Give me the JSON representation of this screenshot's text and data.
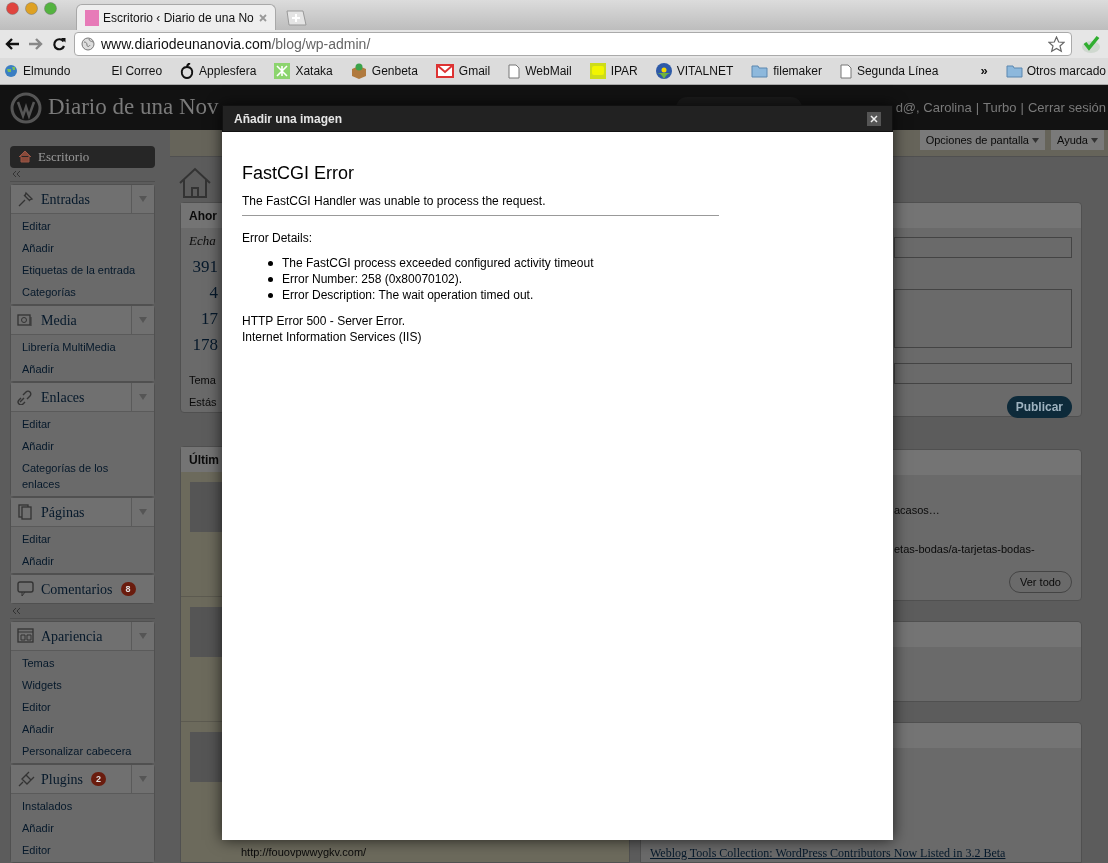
{
  "browser": {
    "tab": {
      "title": "Escritorio ‹ Diario de una No"
    },
    "address": {
      "domain": "www.diariodeunanovia.com",
      "path": "/blog/wp-admin/"
    },
    "bookmarks": [
      {
        "label": "Elmundo",
        "kind": "globe"
      },
      {
        "label": "El Correo",
        "kind": "none"
      },
      {
        "label": "Applesfera",
        "kind": "apple"
      },
      {
        "label": "Xataka",
        "kind": "xataka"
      },
      {
        "label": "Genbeta",
        "kind": "box"
      },
      {
        "label": "Gmail",
        "kind": "mail"
      },
      {
        "label": "WebMail",
        "kind": "page"
      },
      {
        "label": "IPAR",
        "kind": "bubble"
      },
      {
        "label": "VITALNET",
        "kind": "vital"
      },
      {
        "label": "filemaker",
        "kind": "folder"
      },
      {
        "label": "Segunda Línea",
        "kind": "page"
      }
    ],
    "overflow": "»",
    "other_bookmarks": "Otros marcado"
  },
  "admin_bar": {
    "site_title": "Diario de una Nov",
    "greeting": "d@, Carolina",
    "separator": "|",
    "links": [
      "Turbo",
      "Cerrar sesión"
    ]
  },
  "screen_buttons": [
    "Opciones de pantalla",
    "Ayuda"
  ],
  "sidebar": {
    "dashboard": "Escritorio",
    "menus": [
      {
        "label": "Entradas",
        "kind": "pin",
        "items": [
          "Editar",
          "Añadir",
          "Etiquetas de la entrada",
          "Categorías"
        ]
      },
      {
        "label": "Media",
        "kind": "media",
        "items": [
          "Librería MultiMedia",
          "Añadir"
        ]
      },
      {
        "label": "Enlaces",
        "kind": "link",
        "items": [
          "Editar",
          "Añadir",
          "Categorías de los enlaces"
        ]
      },
      {
        "label": "Páginas",
        "kind": "pages",
        "items": [
          "Editar",
          "Añadir"
        ]
      },
      {
        "label": "Comentarios",
        "kind": "comments",
        "badge": "8"
      },
      {
        "label": "Apariencia",
        "kind": "appearance",
        "items": [
          "Temas",
          "Widgets",
          "Editor",
          "Añadir",
          "Personalizar cabecera"
        ]
      },
      {
        "label": "Plugins",
        "kind": "plugins",
        "badge": "2",
        "items": [
          "Instalados",
          "Añadir",
          "Editor"
        ]
      }
    ]
  },
  "right_now": {
    "title": "Ahor",
    "subtitle": "Echa",
    "counts": [
      "391",
      "4",
      "17",
      "178"
    ],
    "lines": [
      "Tema",
      "Estás"
    ]
  },
  "recent_comments": {
    "title": "Últim",
    "url": "http://fouovpwwygkv.com/"
  },
  "quick_press": {
    "button": "Publicar"
  },
  "recent_drafts": {
    "lines": [
      "acasos…",
      "etas-bodas/a-tarjetas-bodas-"
    ],
    "button": "Ver todo"
  },
  "news": {
    "link": "Weblog Tools Collection: WordPress Contributors Now Listed in 3.2 Beta"
  },
  "dialog": {
    "title": "Añadir una imagen",
    "heading": "FastCGI Error",
    "message": "The FastCGI Handler was unable to process the request.",
    "details_label": "Error Details:",
    "details": [
      "The FastCGI process exceeded configured activity timeout",
      "Error Number: 258 (0x80070102).",
      "Error Description: The wait operation timed out."
    ],
    "footer": [
      "HTTP Error 500 - Server Error.",
      "Internet Information Services (IIS)"
    ]
  }
}
